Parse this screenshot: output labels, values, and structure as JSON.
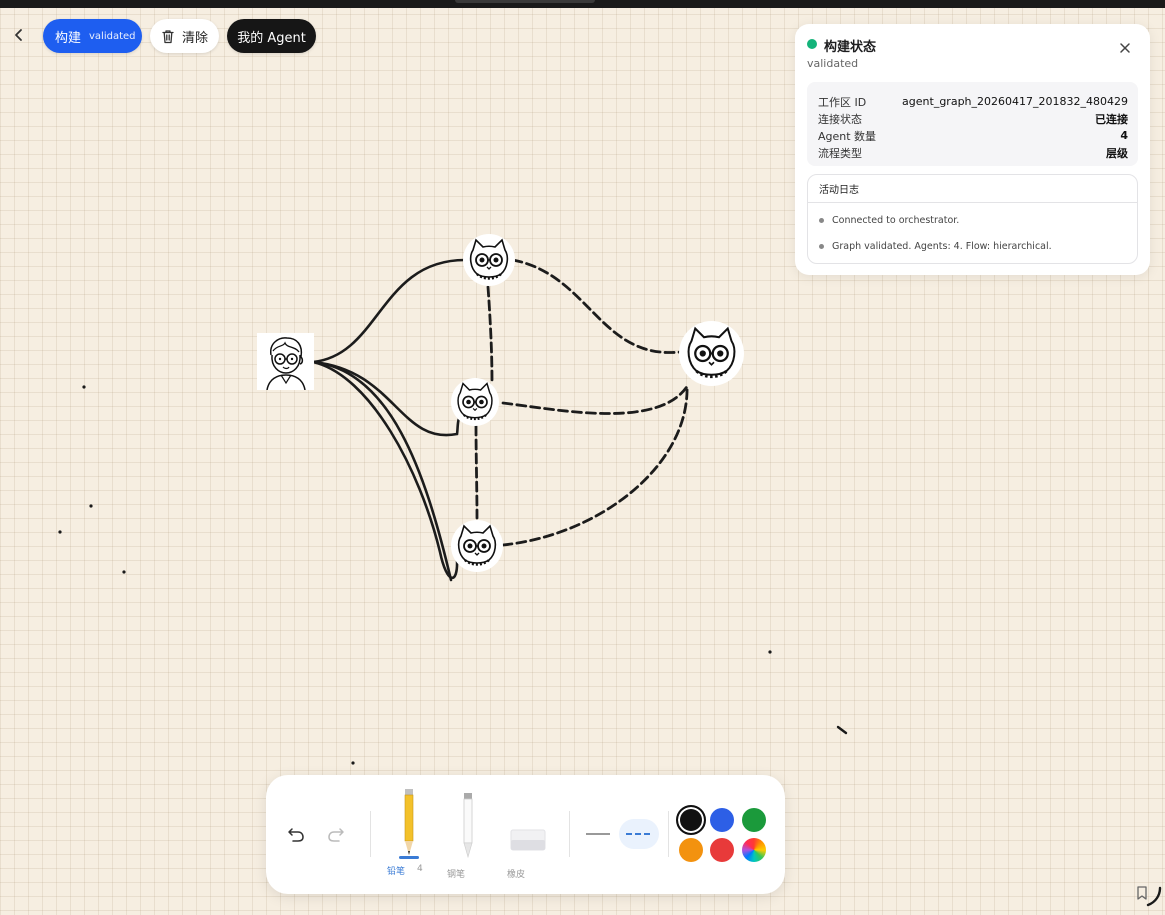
{
  "toolbar_top": {
    "build_label": "构建",
    "build_status": "validated",
    "clear_label": "清除",
    "agent_label": "我的 Agent"
  },
  "status_panel": {
    "title": "构建状态",
    "subtitle": "validated",
    "status_color": "#14b37a",
    "info": [
      {
        "key": "工作区 ID",
        "value": "agent_graph_20260417_201832_480429"
      },
      {
        "key": "连接状态",
        "value": "已连接"
      },
      {
        "key": "Agent 数量",
        "value": "4"
      },
      {
        "key": "流程类型",
        "value": "层级"
      }
    ],
    "log_title": "活动日志",
    "log": [
      "Connected to orchestrator.",
      "Graph validated. Agents: 4. Flow: hierarchical."
    ]
  },
  "graph": {
    "user_node": "user-avatar",
    "agent_nodes": [
      "cat-agent-top",
      "cat-agent-middle",
      "cat-agent-bottom",
      "cat-agent-right"
    ],
    "solid_edges": "user-to-agents",
    "dashed_edges": "agent-to-agent"
  },
  "drawing_toolbar": {
    "pencil_label": "铅笔",
    "pencil_size": "4",
    "pen_label": "钢笔",
    "eraser_label": "橡皮",
    "colors": [
      "#111111",
      "#2d5fe6",
      "#1b9a3b",
      "#f3920f",
      "#e83a3a",
      "rainbow"
    ],
    "selected_color": "#111111",
    "line_styles": [
      "solid",
      "dashed"
    ],
    "selected_line_style": "dashed"
  }
}
